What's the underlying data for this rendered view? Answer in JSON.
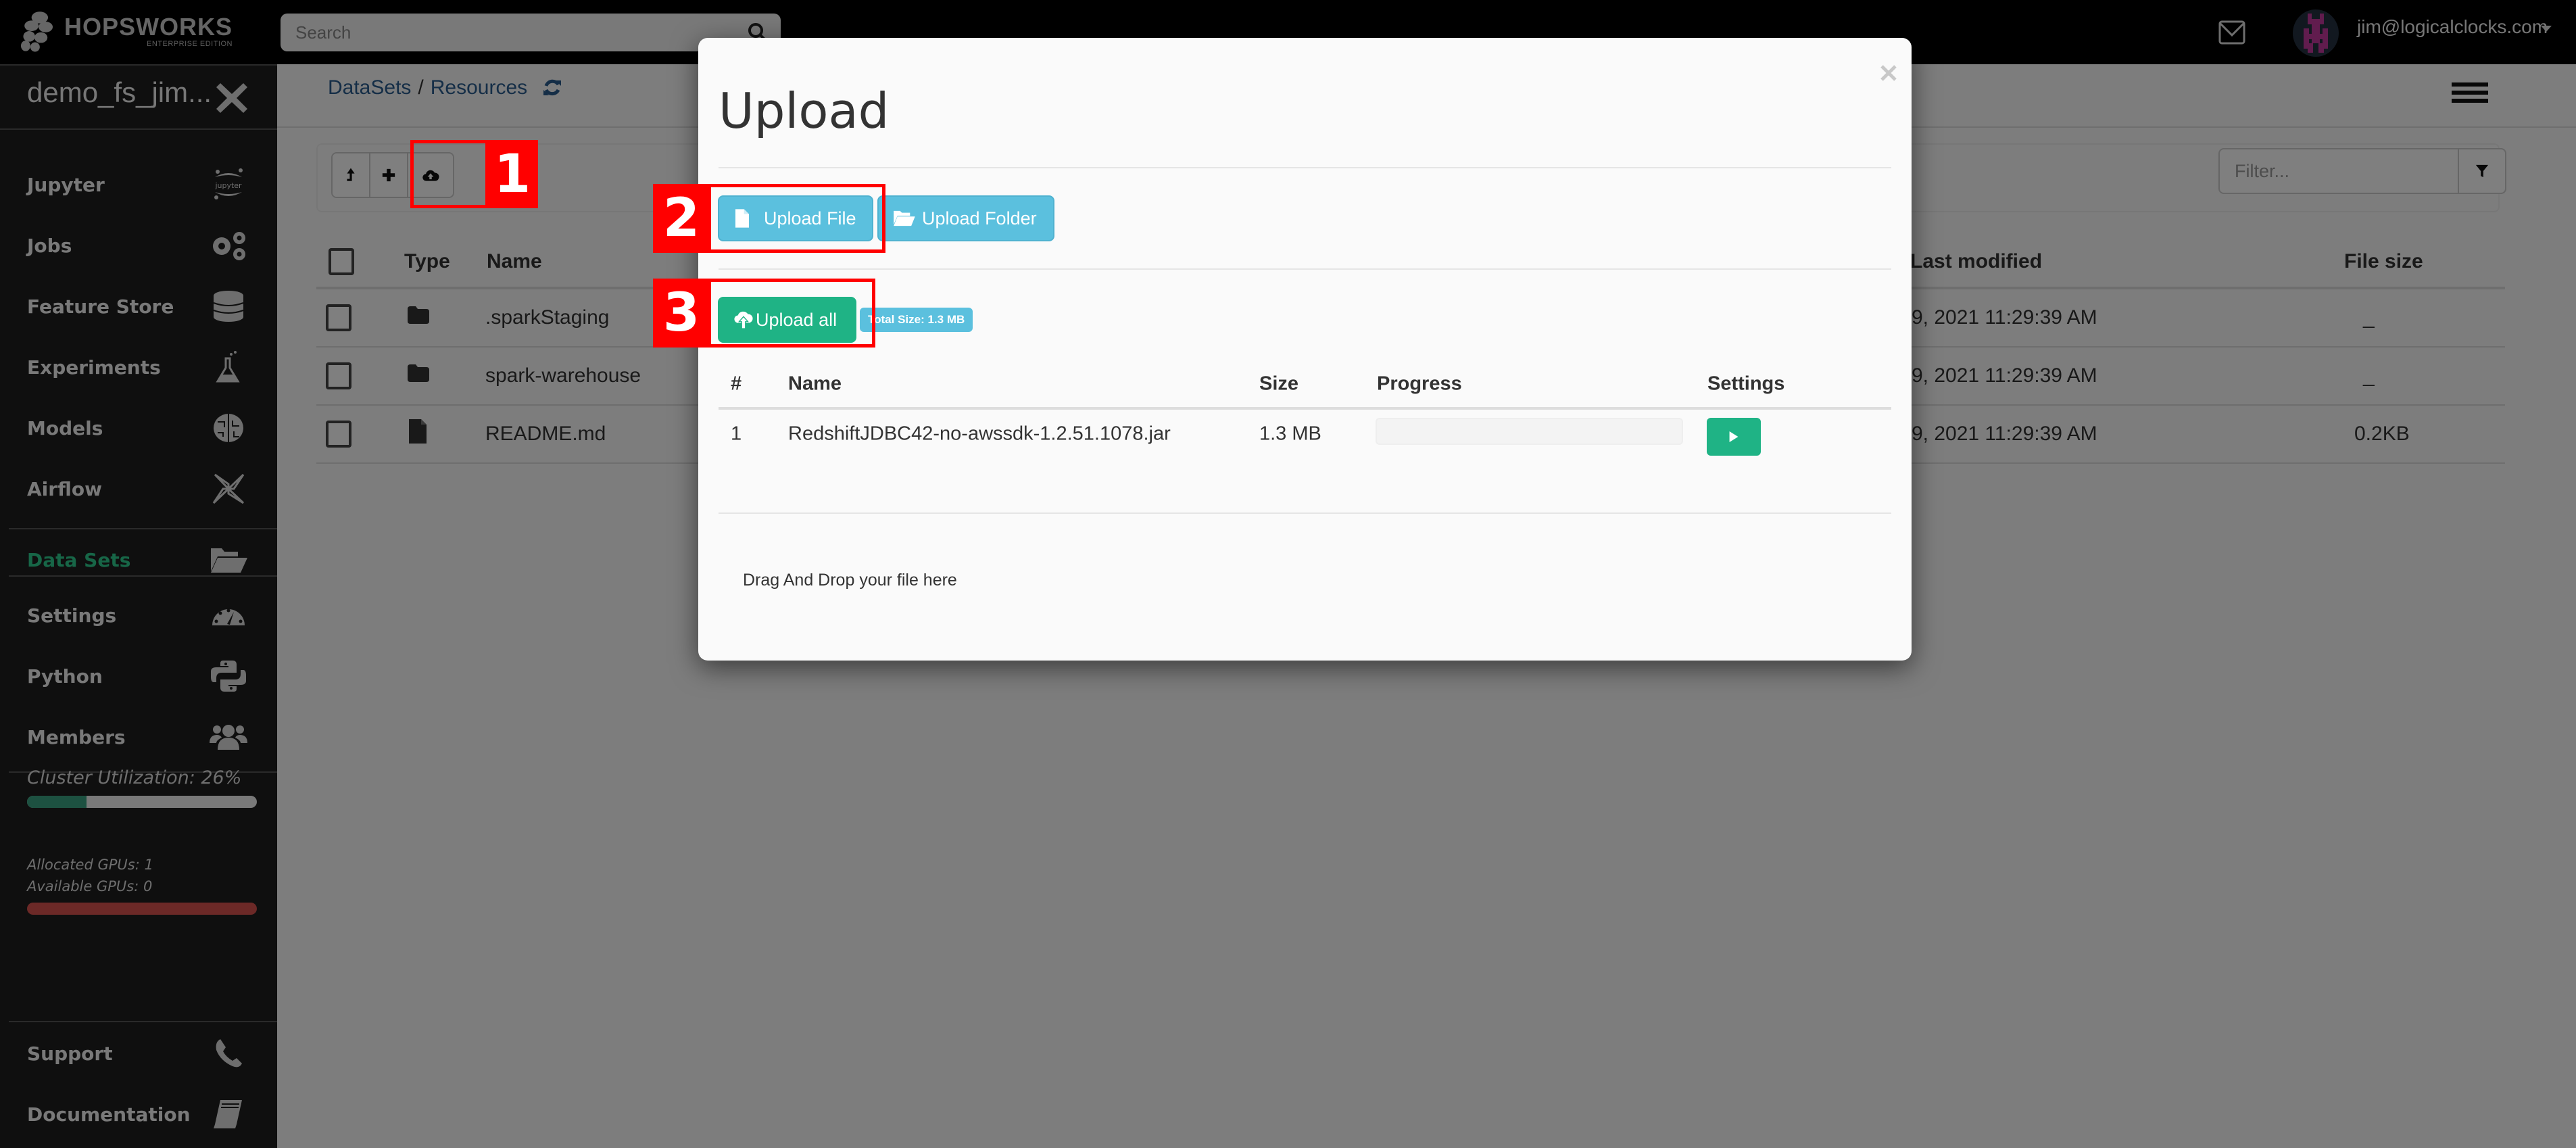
{
  "topbar": {
    "brand": "HOPSWORKS",
    "edition": "ENTERPRISE EDITION",
    "search_placeholder": "Search",
    "user_email": "jim@logicalclocks.com"
  },
  "sidebar": {
    "project_name": "demo_fs_jim...",
    "items": [
      {
        "label": "Jupyter",
        "icon": "jupyter-icon"
      },
      {
        "label": "Jobs",
        "icon": "gears-icon"
      },
      {
        "label": "Feature Store",
        "icon": "database-icon"
      },
      {
        "label": "Experiments",
        "icon": "flask-icon"
      },
      {
        "label": "Models",
        "icon": "brain-icon"
      },
      {
        "label": "Airflow",
        "icon": "pinwheel-icon"
      },
      {
        "label": "Data Sets",
        "icon": "folder-open-icon",
        "active": true
      },
      {
        "label": "Settings",
        "icon": "dashboard-icon"
      },
      {
        "label": "Python",
        "icon": "python-icon"
      },
      {
        "label": "Members",
        "icon": "users-icon"
      }
    ],
    "cluster_utilization_label": "Cluster Utilization: 26%",
    "cluster_utilization": 0.26,
    "allocated_gpus_label": "Allocated GPUs: 1",
    "available_gpus_label": "Available GPUs: 0",
    "footer_items": [
      {
        "label": "Support",
        "icon": "phone-icon"
      },
      {
        "label": "Documentation",
        "icon": "book-icon"
      }
    ],
    "colors": {
      "active": "#2ecc8f",
      "util_fill": "#3aa383",
      "gpu_bar": "#d9534f"
    }
  },
  "main": {
    "breadcrumb": [
      "DataSets",
      "Resources"
    ],
    "filter_placeholder": "Filter...",
    "table": {
      "columns": [
        "Type",
        "Name",
        "Last modified",
        "File size"
      ],
      "rows": [
        {
          "type": "folder",
          "name": ".sparkStaging",
          "modified": "9, 2021 11:29:39 AM",
          "size": "_"
        },
        {
          "type": "folder",
          "name": "spark-warehouse",
          "modified": "9, 2021 11:29:39 AM",
          "size": "_"
        },
        {
          "type": "file",
          "name": "README.md",
          "modified": "9, 2021 11:29:39 AM",
          "size": "0.2KB"
        }
      ],
      "modified_header_visible": "t modified"
    }
  },
  "modal": {
    "title": "Upload",
    "close": "×",
    "upload_file_label": "Upload File",
    "upload_folder_label": "Upload Folder",
    "upload_all_label": "Upload all",
    "total_size_badge": "Total Size: 1.3 MB",
    "table": {
      "columns": [
        "#",
        "Name",
        "Size",
        "Progress",
        "Settings"
      ],
      "rows": [
        {
          "index": "1",
          "name": "RedshiftJDBC42-no-awssdk-1.2.51.1078.jar",
          "size": "1.3 MB",
          "progress": 0
        }
      ]
    },
    "drop_text": "Drag And Drop your file here",
    "colors": {
      "info": "#5bc0de",
      "success": "#1fb385"
    }
  },
  "annotations": [
    "1",
    "2",
    "3"
  ]
}
